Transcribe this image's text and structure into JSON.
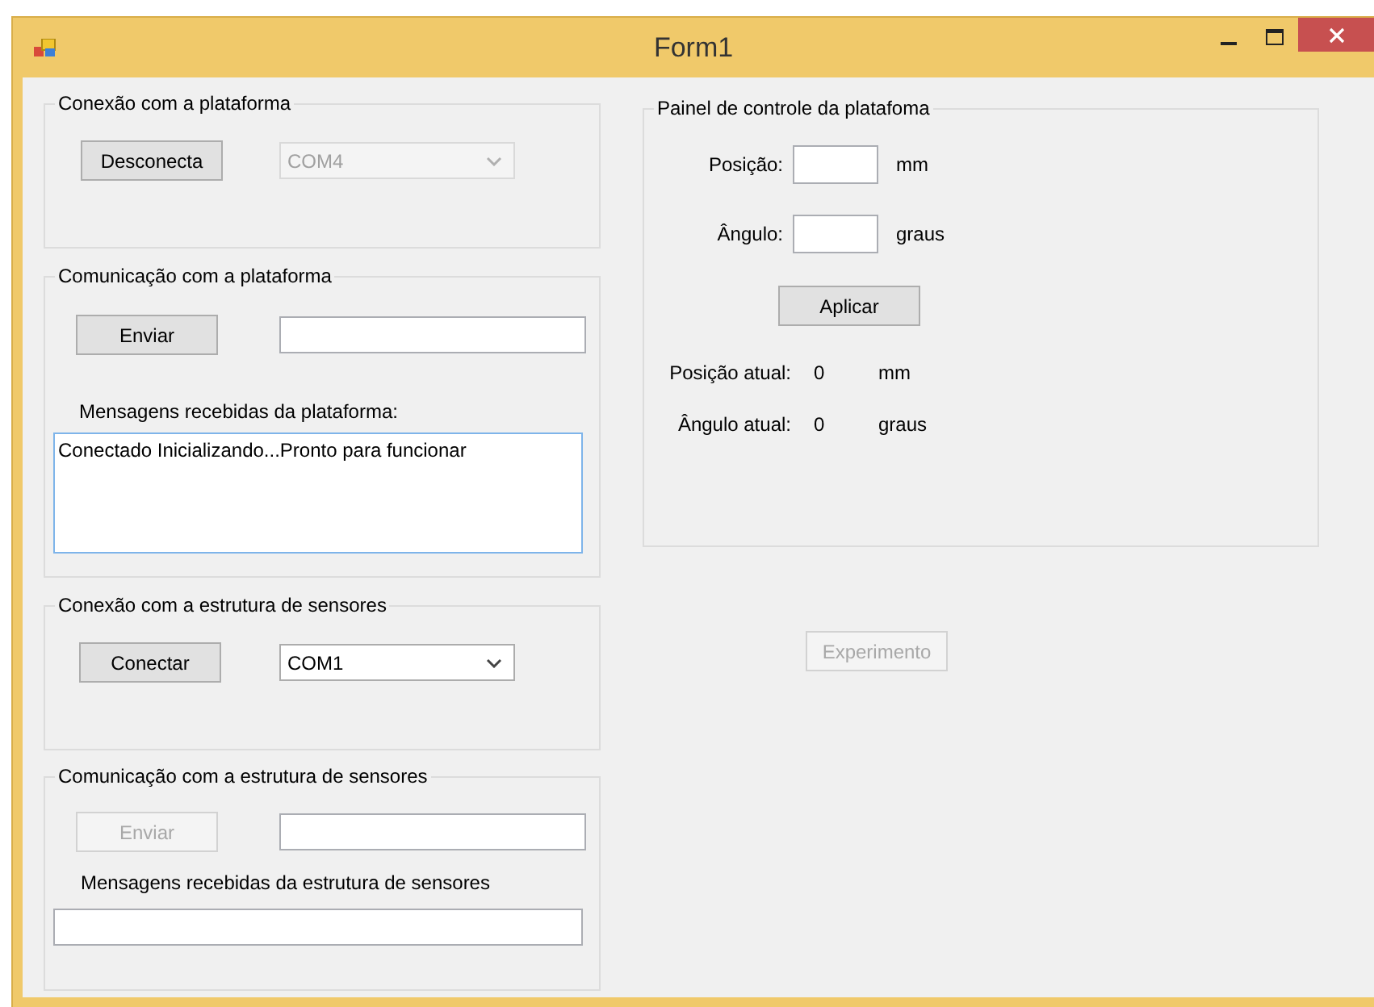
{
  "window": {
    "title": "Form1"
  },
  "platform_connection": {
    "title": "Conexão com a plataforma",
    "button": {
      "label": "Desconecta",
      "disabled": false
    },
    "port": {
      "value": "COM4",
      "disabled": true
    }
  },
  "platform_communication": {
    "title": "Comunicação com a plataforma",
    "send_button": {
      "label": "Enviar",
      "disabled": false
    },
    "messages_label": "Mensagens recebidas da plataforma:",
    "messages": "Conectado Inicializando...Pronto para funcionar"
  },
  "sensor_connection": {
    "title": "Conexão com a estrutura de sensores",
    "button": {
      "label": "Conectar",
      "disabled": false
    },
    "port": {
      "value": "COM1",
      "disabled": false
    }
  },
  "sensor_communication": {
    "title": "Comunicação com a estrutura de sensores",
    "send_button": {
      "label": "Enviar",
      "disabled": true
    },
    "messages_label": "Mensagens recebidas da estrutura de sensores"
  },
  "control_panel": {
    "title": "Painel de controle da platafoma",
    "fields": [
      {
        "label": "Posição:",
        "unit": "mm"
      },
      {
        "label": "Ângulo:",
        "unit": "graus"
      }
    ],
    "apply_button": {
      "label": "Aplicar",
      "disabled": false
    },
    "readings": [
      {
        "label": "Posição atual:",
        "value": "0",
        "unit": "mm"
      },
      {
        "label": "Ângulo atual:",
        "value": "0",
        "unit": "graus"
      }
    ]
  },
  "experiment_button": {
    "label": "Experimento",
    "disabled": true
  }
}
